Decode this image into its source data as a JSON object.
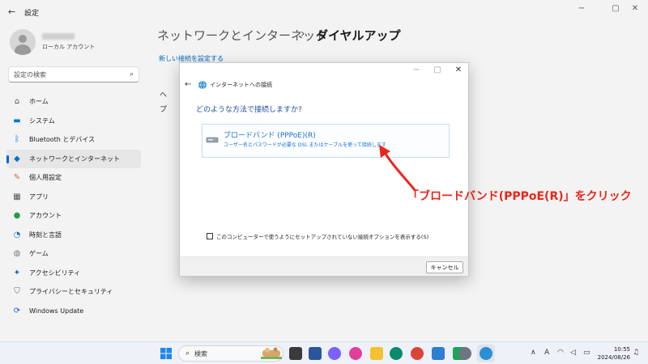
{
  "window": {
    "title": "設定",
    "back_glyph": "←",
    "min_glyph": "−",
    "max_glyph": "▢",
    "close_glyph": "✕"
  },
  "profile": {
    "account_type": "ローカル アカウント"
  },
  "search": {
    "placeholder": "設定の検索",
    "icon": "search-icon"
  },
  "nav": {
    "items": [
      {
        "label": "ホーム",
        "icon": "home-icon",
        "glyph": "⌂",
        "color": "#555555"
      },
      {
        "label": "システム",
        "icon": "system-icon",
        "glyph": "▬",
        "color": "#0078d4"
      },
      {
        "label": "Bluetooth とデバイス",
        "icon": "bluetooth-icon",
        "glyph": "ᛒ",
        "color": "#0078d4"
      },
      {
        "label": "ネットワークとインターネット",
        "icon": "network-icon",
        "glyph": "◆",
        "color": "#0b6bc4"
      },
      {
        "label": "個人用設定",
        "icon": "personalization-icon",
        "glyph": "✎",
        "color": "#c0704a"
      },
      {
        "label": "アプリ",
        "icon": "apps-icon",
        "glyph": "▦",
        "color": "#555555"
      },
      {
        "label": "アカウント",
        "icon": "account-icon",
        "glyph": "●",
        "color": "#2a9d4c"
      },
      {
        "label": "時刻と言語",
        "icon": "time-language-icon",
        "glyph": "◔",
        "color": "#0b6bc4"
      },
      {
        "label": "ゲーム",
        "icon": "gaming-icon",
        "glyph": "◍",
        "color": "#777777"
      },
      {
        "label": "アクセシビリティ",
        "icon": "accessibility-icon",
        "glyph": "✦",
        "color": "#0b6bc4"
      },
      {
        "label": "プライバシーとセキュリティ",
        "icon": "shield-icon",
        "glyph": "⛉",
        "color": "#666666"
      },
      {
        "label": "Windows Update",
        "icon": "update-icon",
        "glyph": "⟳",
        "color": "#0b6bc4"
      }
    ],
    "active_index": 3
  },
  "main": {
    "breadcrumb_parent": "ネットワークとインターネット",
    "breadcrumb_sep": "›",
    "breadcrumb_current": "ダイヤルアップ",
    "new_connection_link": "新しい接続を設定する",
    "behind_item1": "ヘ",
    "behind_item2": "プ"
  },
  "dialog": {
    "title": "インターネットへの接続",
    "back_glyph": "←",
    "question": "どのような方法で接続しますか?",
    "option_title": "ブロードバンド (PPPoE)(R)",
    "option_desc": "ユーザー名とパスワードが必要な DSL またはケーブルを使って接続します",
    "checkbox_label": "このコンピューターで使うようにセットアップされていない接続オプションを表示する(S)",
    "checkbox_checked": false,
    "cancel_label": "キャンセル"
  },
  "annotation": {
    "text": "「ブロードバンド(PPPoE(R)」をクリック",
    "color": "#e8261a"
  },
  "taskbar": {
    "search_placeholder": "検索",
    "ime_indicator": "A",
    "tray_chevron": "∧",
    "time": "10:55",
    "date": "2024/08/26"
  }
}
